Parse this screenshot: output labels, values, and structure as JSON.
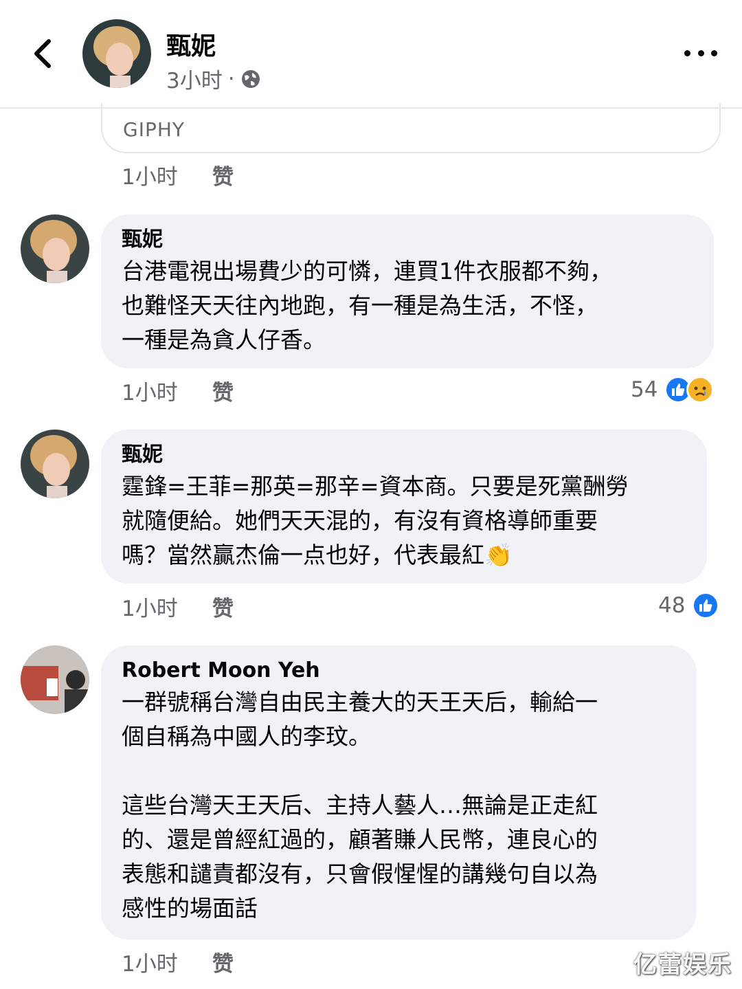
{
  "header": {
    "name": "甄妮",
    "time": "3小时",
    "separator": "·",
    "back_icon": "chevron-left-icon",
    "privacy_icon": "globe-icon",
    "more_icon": "more-horizontal-icon"
  },
  "giphy": {
    "label": "GIPHY"
  },
  "comments": [
    {
      "time": "1小时",
      "like_label": "赞"
    },
    {
      "author": "甄妮",
      "text": "台港電視出場費少的可憐，連買1件衣服都不夠，\n也難怪天天往內地跑，有一種是為生活，不怪，\n一種是為貪人仔香。",
      "time": "1小时",
      "like_label": "赞",
      "reaction_count": "54",
      "reactions": [
        "like-icon",
        "sad-icon"
      ]
    },
    {
      "author": "甄妮",
      "text": "霆鋒=王菲=那英=那辛=資本商。只要是死黨酬勞\n就隨便給。她們天天混的，有沒有資格導師重要\n嗎？當然贏杰倫一点也好，代表最紅",
      "emoji": "👏",
      "time": "1小时",
      "like_label": "赞",
      "reaction_count": "48",
      "reactions": [
        "like-icon"
      ]
    },
    {
      "author": "Robert Moon Yeh",
      "text": "一群號稱台灣自由民主養大的天王天后，輸給一\n個自稱為中國人的李玟。\n\n這些台灣天王天后、主持人藝人…無論是正走紅\n的、還是曾經紅過的，顧著賺人民幣，連良心的\n表態和譴責都沒有，只會假惺惺的講幾句自以為\n感性的場面話",
      "time": "1小时",
      "like_label": "赞"
    }
  ],
  "watermark": "亿蕾娱乐",
  "colors": {
    "bubble": "#f0f2f5",
    "meta_text": "#65676b",
    "like_blue": "#1877f2",
    "sad_yellow": "#f7b125"
  }
}
